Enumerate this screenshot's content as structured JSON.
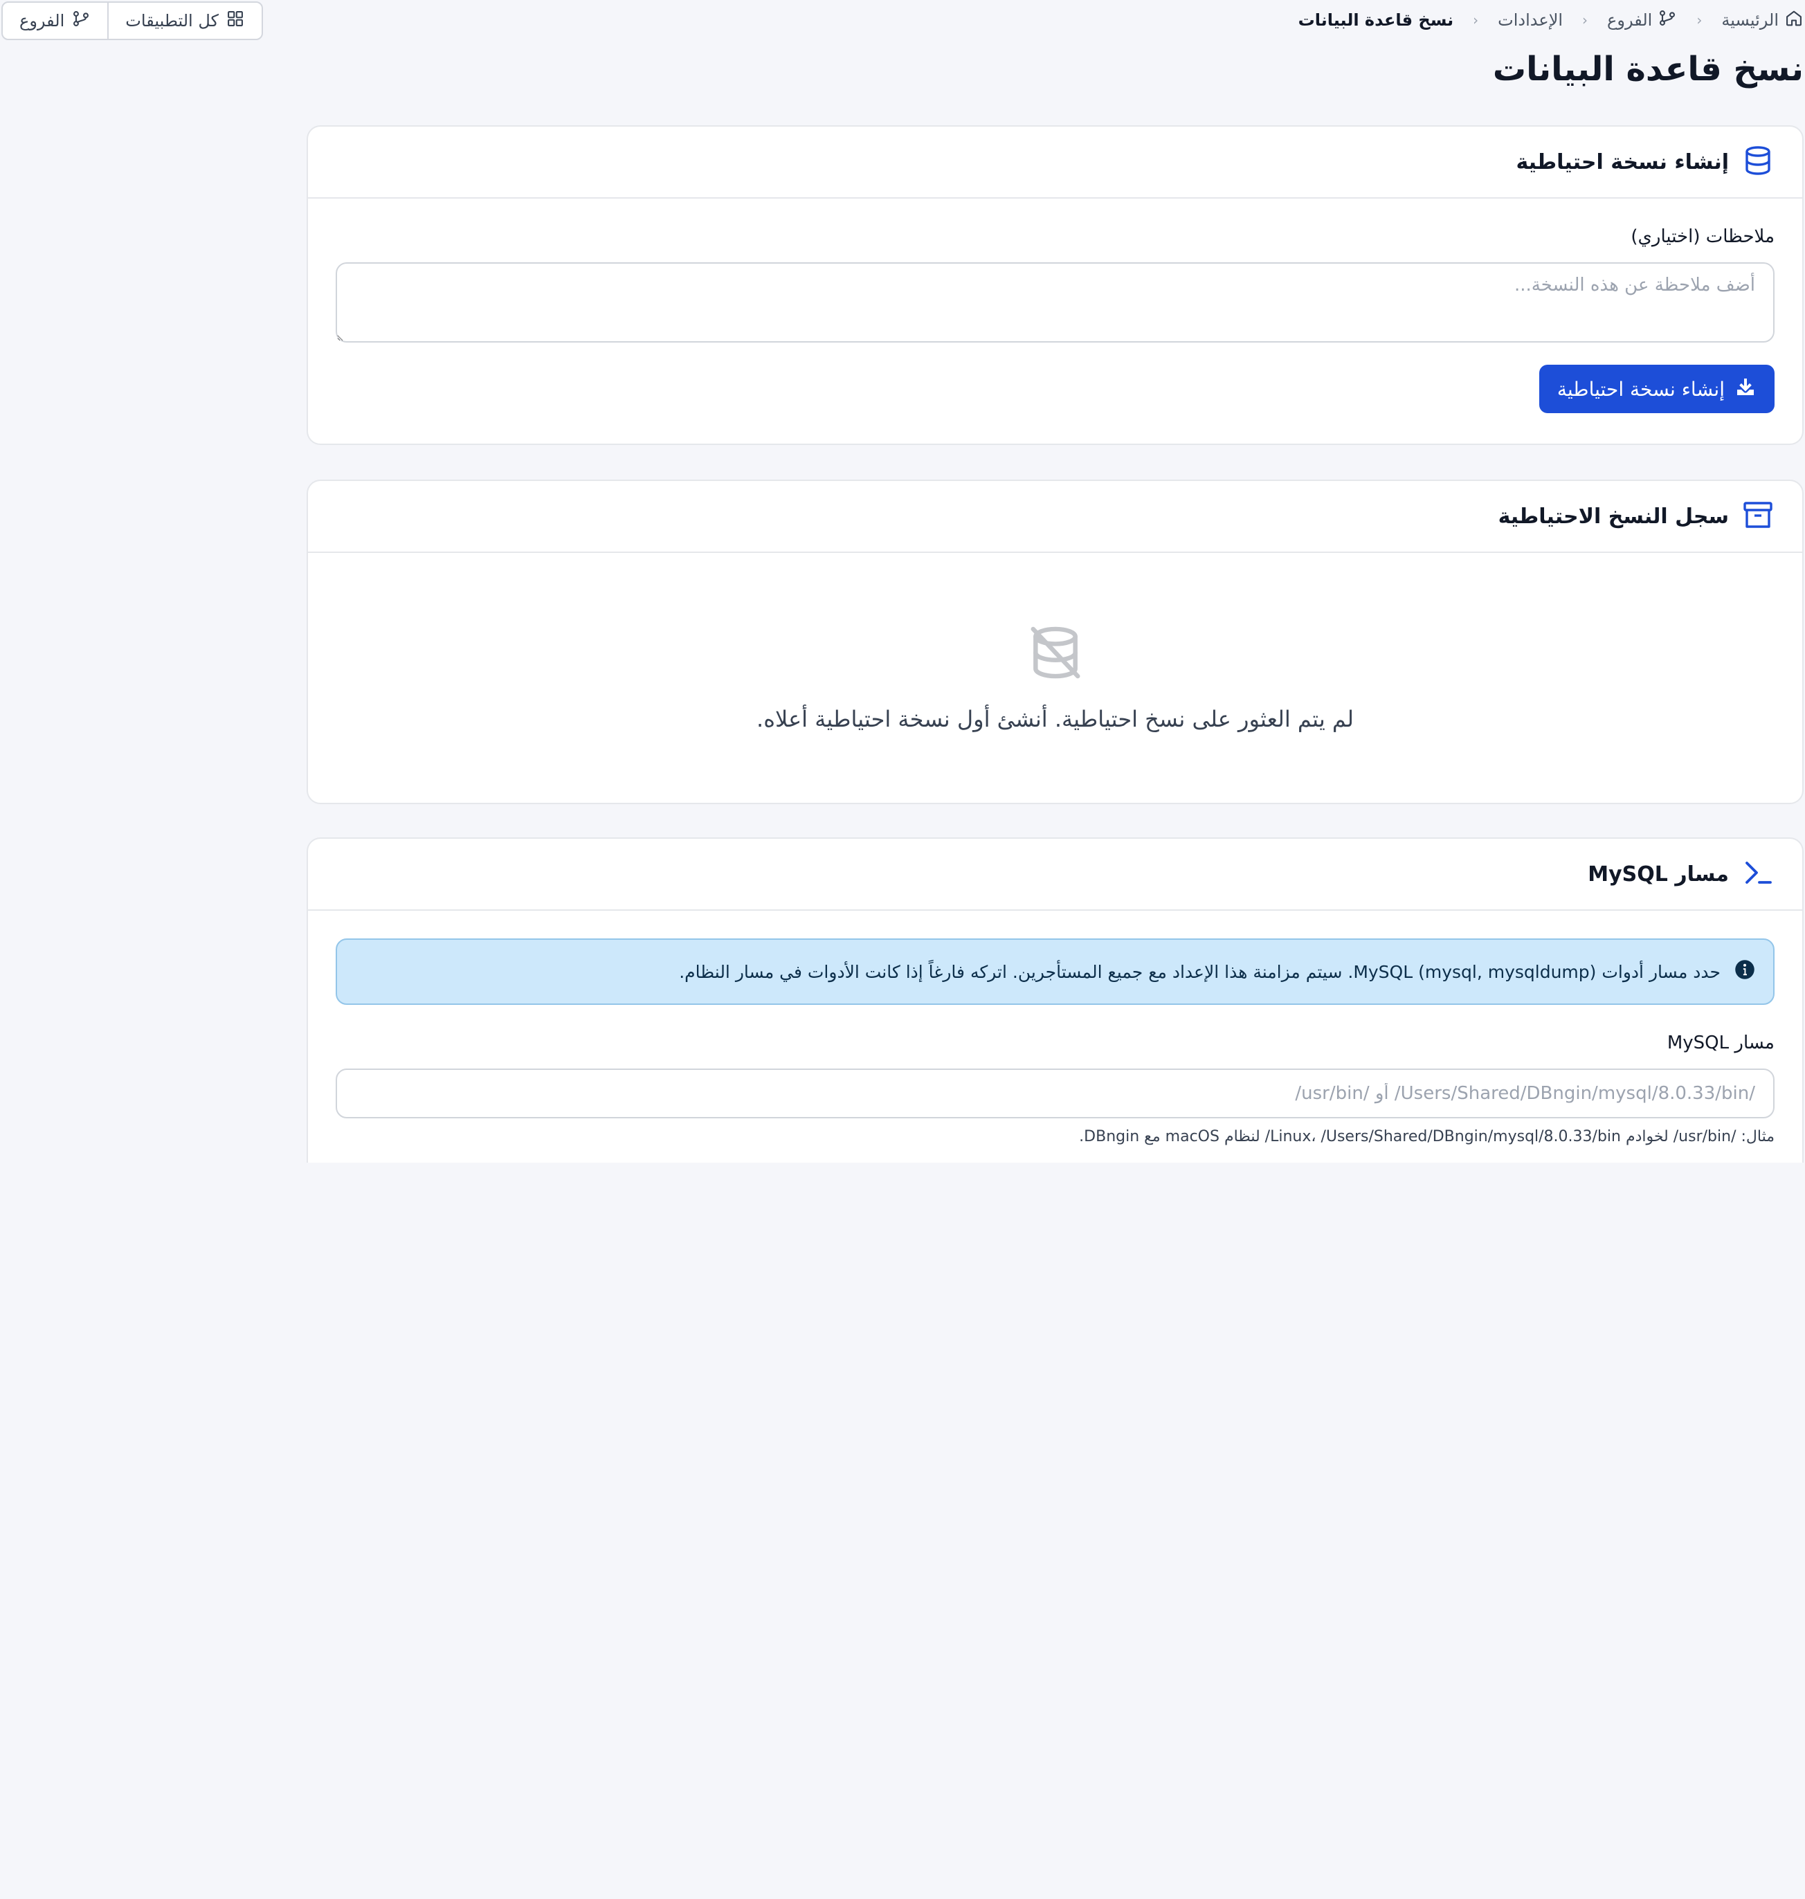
{
  "header": {
    "breadcrumb": [
      {
        "label": "الرئيسية",
        "icon": "home-icon"
      },
      {
        "label": "الفروع",
        "icon": "branch-icon"
      },
      {
        "label": "الإعدادات"
      },
      {
        "label": "نسخ قاعدة البيانات"
      }
    ],
    "breadcrumb_separator": "‹",
    "quick_actions": {
      "all_apps_label": "كل التطبيقات",
      "branches_label": "الفروع"
    }
  },
  "page": {
    "title": "نسخ قاعدة البيانات"
  },
  "create_backup": {
    "title": "إنشاء نسخة احتياطية",
    "notes_label": "ملاحظات (اختياري)",
    "notes_placeholder": "أضف ملاحظة عن هذه النسخة...",
    "notes_value": "",
    "button_label": "إنشاء نسخة احتياطية"
  },
  "backup_history": {
    "title": "سجل النسخ الاحتياطية",
    "empty_message": "لم يتم العثور على نسخ احتياطية. أنشئ أول نسخة احتياطية أعلاه."
  },
  "mysql_path": {
    "title": "مسار MySQL",
    "info_text": "حدد مسار أدوات MySQL (mysql, mysqldump). سيتم مزامنة هذا الإعداد مع جميع المستأجرين. اتركه فارغاً إذا كانت الأدوات في مسار النظام.",
    "field_label": "مسار MySQL",
    "field_placeholder": "/Users/Shared/DBngin/mysql/8.0.33/bin/ أو /usr/bin/",
    "field_value": "",
    "help_text": "مثال: /usr/bin/ لخوادم Linux، /Users/Shared/DBngin/mysql/8.0.33/bin/ لنظام macOS مع DBngin."
  },
  "colors": {
    "accent": "#1d4ed8",
    "page_background": "#f5f6fa",
    "info_background": "#cde8fb"
  }
}
